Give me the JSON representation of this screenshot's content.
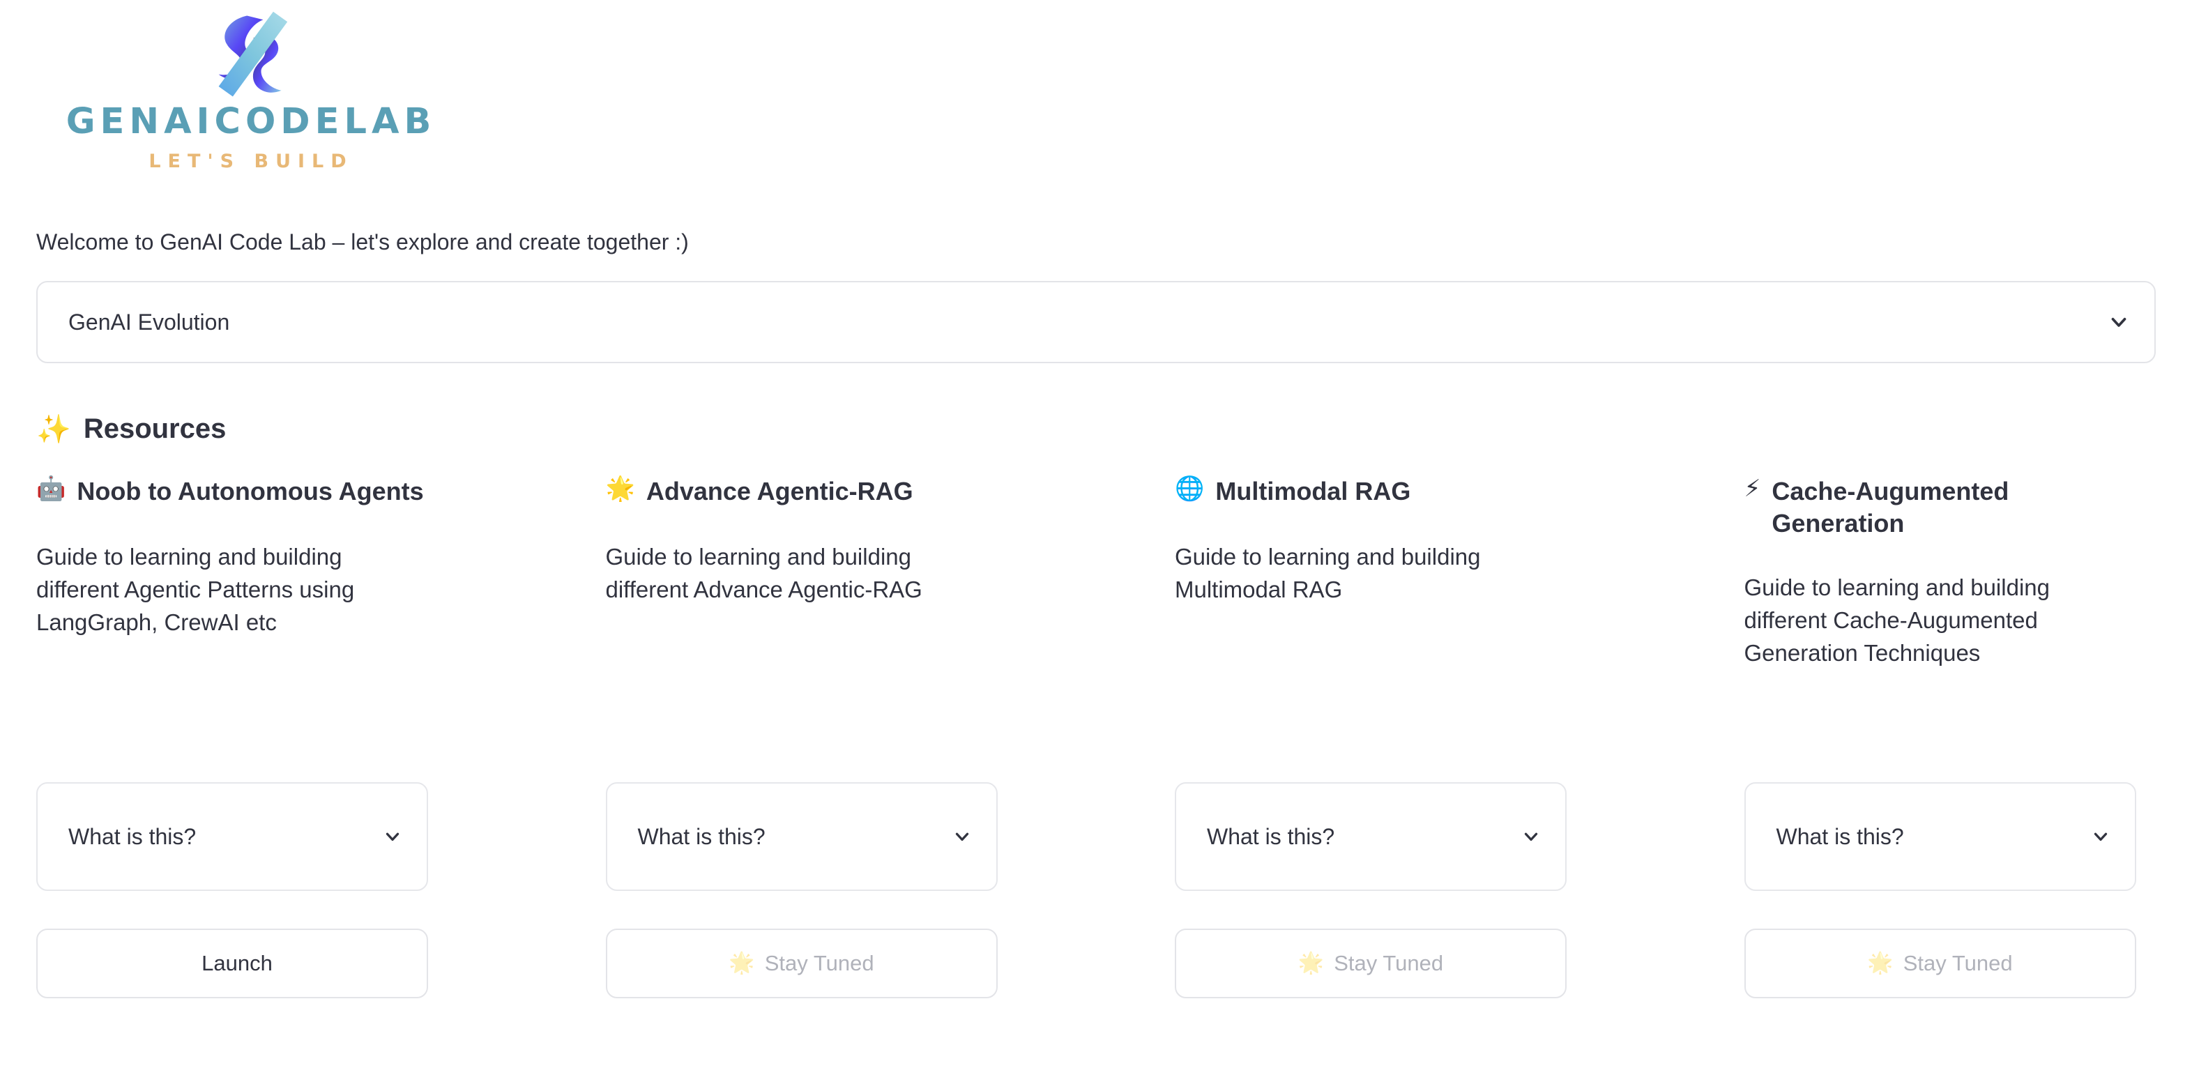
{
  "brand": {
    "wordmark": "GENAICODELAB",
    "tagline": "LET'S BUILD",
    "wordmark_color": "#5a9fb5",
    "tagline_color": "#e8b876",
    "logo_icon": "code-brackets-icon"
  },
  "welcome": {
    "text": "Welcome to GenAI Code Lab – let's explore and create together :)"
  },
  "selector": {
    "value": "GenAI Evolution",
    "chevron_icon": "chevron-down-icon"
  },
  "resources": {
    "icon": "sparkles-icon",
    "emoji": "✨",
    "title": "Resources"
  },
  "cards": [
    {
      "emoji": "🤖",
      "icon_name": "robot-icon",
      "title": "Noob to Autonomous Agents",
      "description": "Guide to learning and building different Agentic Patterns using LangGraph, CrewAI etc",
      "expander_label": "What is this?",
      "expander_icon": "chevron-down-icon",
      "button_label": "Launch",
      "button_emoji": "",
      "button_disabled": false
    },
    {
      "emoji": "🌟",
      "icon_name": "glowing-star-icon",
      "title": "Advance Agentic-RAG",
      "description": "Guide to learning and building different Advance Agentic-RAG",
      "expander_label": "What is this?",
      "expander_icon": "chevron-down-icon",
      "button_label": "Stay Tuned",
      "button_emoji": "🌟",
      "button_disabled": true
    },
    {
      "emoji": "🌐",
      "icon_name": "globe-icon",
      "title": "Multimodal RAG",
      "description": "Guide to learning and building Multimodal RAG",
      "expander_label": "What is this?",
      "expander_icon": "chevron-down-icon",
      "button_label": "Stay Tuned",
      "button_emoji": "🌟",
      "button_disabled": true
    },
    {
      "emoji": "⚡",
      "icon_name": "lightning-bolt-icon",
      "title": "Cache-Augumented Generation",
      "description": "Guide to learning and building different Cache-Augumented Generation Techniques",
      "expander_label": "What is this?",
      "expander_icon": "chevron-down-icon",
      "button_label": "Stay Tuned",
      "button_emoji": "🌟",
      "button_disabled": true
    }
  ]
}
